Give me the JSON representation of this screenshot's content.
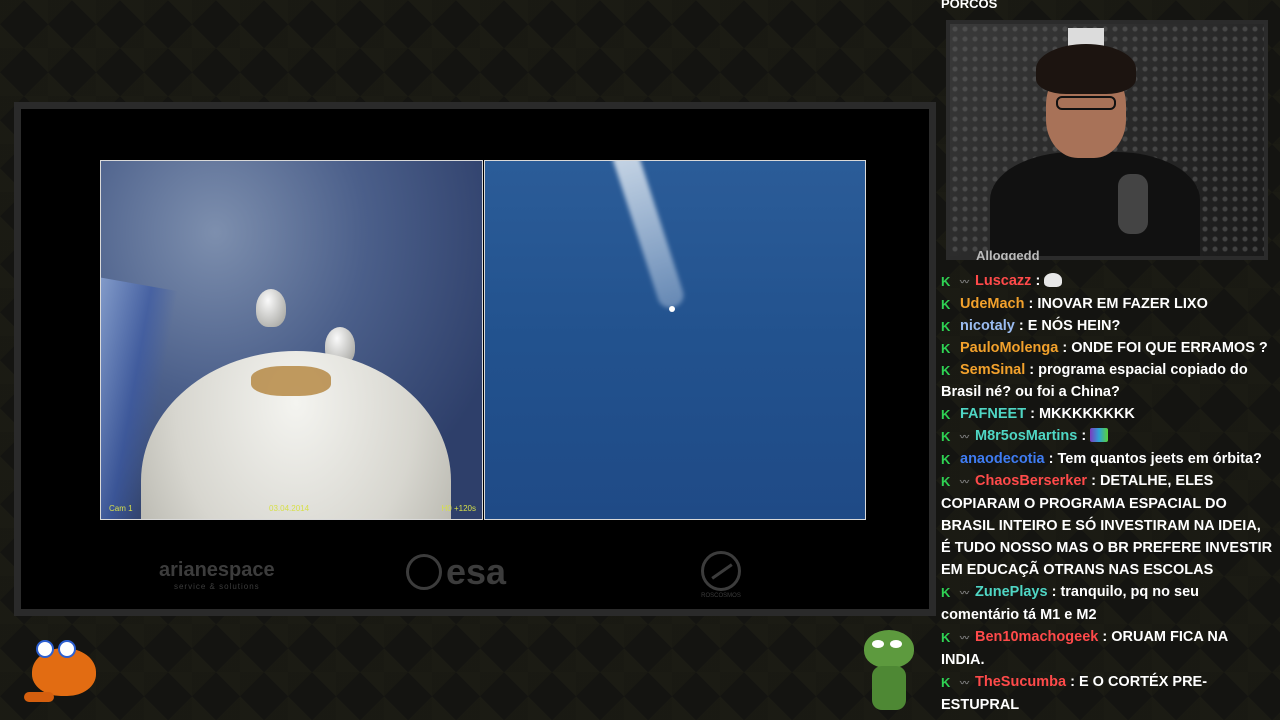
{
  "chat_partial_top": "PORCOS",
  "chat_partial_user": "Alloggedd",
  "stream": {
    "cam_label": "Cam 1",
    "date_label": "03.04.2014",
    "time_label": "H0 +120s",
    "logos": {
      "arianespace": "arianespace",
      "arianespace_sub": "service & solutions",
      "esa": "esa",
      "roscosmos": "ROSCOSMOS"
    }
  },
  "chat": {
    "messages": [
      {
        "user": "Luscazz",
        "color": "#ff4a4a",
        "badge": "sub-icon",
        "text": "",
        "emote": "skull"
      },
      {
        "user": "UdeMach",
        "color": "#f2a12c",
        "badge": "",
        "text": "INOVAR EM FAZER LIXO"
      },
      {
        "user": "nicotaly",
        "color": "#9bbcf0",
        "badge": "",
        "text": "E NÓS HEIN?"
      },
      {
        "user": "PauloMolenga",
        "color": "#f2a12c",
        "badge": "",
        "text": "ONDE FOI QUE ERRAMOS ?"
      },
      {
        "user": "SemSinal",
        "color": "#f2a12c",
        "badge": "",
        "text": "programa espacial copiado do Brasil né? ou foi a China?"
      },
      {
        "user": "FAFNEET",
        "color": "#4fd6c4",
        "badge": "",
        "text": "MKKKKKKKK"
      },
      {
        "user": "M8r5osMartins",
        "color": "#4fd6c4",
        "badge": "sub-icon",
        "text": "",
        "emote": "pc"
      },
      {
        "user": "anaodecotia",
        "color": "#3f7cf2",
        "badge": "",
        "text": "Tem quantos jeets em órbita?"
      },
      {
        "user": "ChaosBerserker",
        "color": "#ff4a4a",
        "badge": "sub-icon",
        "text": "DETALHE, ELES COPIARAM O PROGRAMA ESPACIAL DO BRASIL INTEIRO E SÓ INVESTIRAM NA IDEIA, É TUDO NOSSO MAS O BR PREFERE INVESTIR EM EDUCAÇÃ OTRANS NAS ESCOLAS"
      },
      {
        "user": "ZunePlays",
        "color": "#4fd6c4",
        "badge": "sub-icon",
        "text": "tranquilo, pq no seu comentário tá M1 e M2"
      },
      {
        "user": "Ben10machogeek",
        "color": "#ff4a4a",
        "badge": "sub-icon",
        "text": "ORUAM FICA NA INDIA."
      },
      {
        "user": "TheSucumba",
        "color": "#ff4a4a",
        "badge": "sub-icon",
        "text": "E O CORTÉX PRE-ESTUPRAL"
      }
    ],
    "prefix_icon": "k-icon"
  }
}
